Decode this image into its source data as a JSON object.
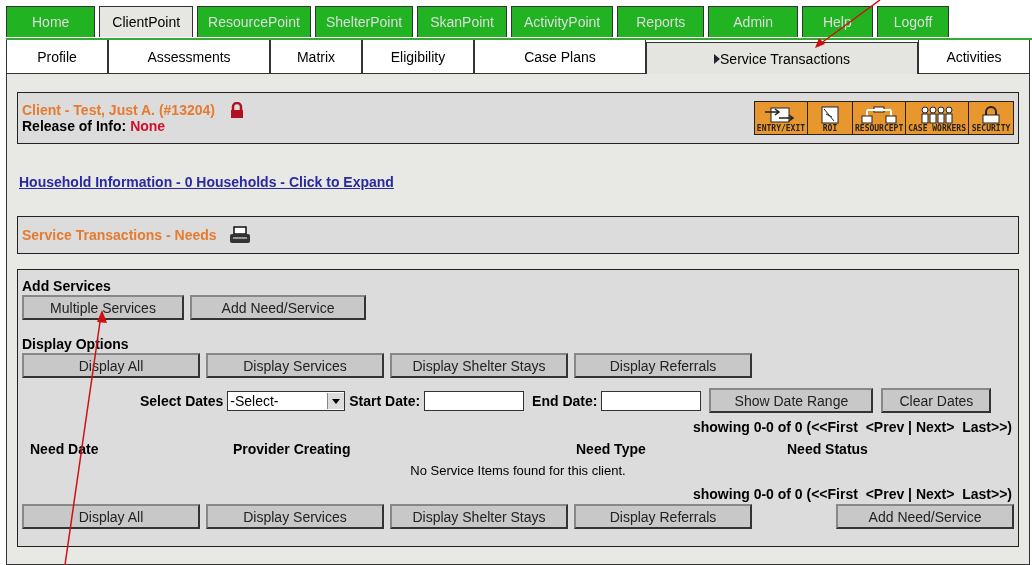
{
  "main_tabs": [
    {
      "label": "Home",
      "selected": false
    },
    {
      "label": "ClientPoint",
      "selected": true
    },
    {
      "label": "ResourcePoint",
      "selected": false
    },
    {
      "label": "ShelterPoint",
      "selected": false
    },
    {
      "label": "SkanPoint",
      "selected": false
    },
    {
      "label": "ActivityPoint",
      "selected": false
    },
    {
      "label": "Reports",
      "selected": false
    },
    {
      "label": "Admin",
      "selected": false
    },
    {
      "label": "Help",
      "selected": false
    },
    {
      "label": "Logoff",
      "selected": false
    }
  ],
  "sub_tabs": [
    {
      "label": "Profile",
      "selected": false
    },
    {
      "label": "Assessments",
      "selected": false
    },
    {
      "label": "Matrix",
      "selected": false
    },
    {
      "label": "Eligibility",
      "selected": false
    },
    {
      "label": "Case Plans",
      "selected": false
    },
    {
      "label": "Service Transactions",
      "selected": true
    },
    {
      "label": "Activities",
      "selected": false
    }
  ],
  "client_header": {
    "title": "Client - Test, Just A. (#13204)",
    "roi_label": "Release of Info:",
    "roi_value": "None",
    "toolbar": [
      {
        "kind": "entry_exit",
        "label": "ENTRY/EXIT"
      },
      {
        "kind": "roi",
        "label": "ROI"
      },
      {
        "kind": "resourcept",
        "label": "RESOURCEPT"
      },
      {
        "kind": "case_workers",
        "label": "CASE WORKERS"
      },
      {
        "kind": "security",
        "label": "SECURITY"
      }
    ]
  },
  "household_link": "Household Information - 0 Households - Click to Expand",
  "section_title": "Service Transactions - Needs",
  "add_services": {
    "title": "Add Services",
    "buttons": [
      "Multiple Services",
      "Add Need/Service"
    ]
  },
  "display_options": {
    "title": "Display Options",
    "buttons": [
      "Display All",
      "Display Services",
      "Display Shelter Stays",
      "Display Referrals"
    ]
  },
  "date_filter": {
    "select_label": "Select Dates",
    "select_value": "-Select-",
    "start_label": "Start Date:",
    "end_label": "End Date:",
    "buttons": [
      "Show Date Range",
      "Clear Dates"
    ]
  },
  "pagination_top": "showing 0-0 of 0 (<<First  <Prev | Next>  Last>>)",
  "table": {
    "columns": [
      "Need Date",
      "Provider Creating",
      "Need Type",
      "Need Status"
    ],
    "empty_message": "No Service Items found for this client."
  },
  "pagination_bottom": "showing 0-0 of 0 (<<First  <Prev | Next>  Last>>)",
  "bottom_buttons": [
    "Display All",
    "Display Services",
    "Display Shelter Stays",
    "Display Referrals"
  ],
  "bottom_add_button": "Add Need/Service"
}
